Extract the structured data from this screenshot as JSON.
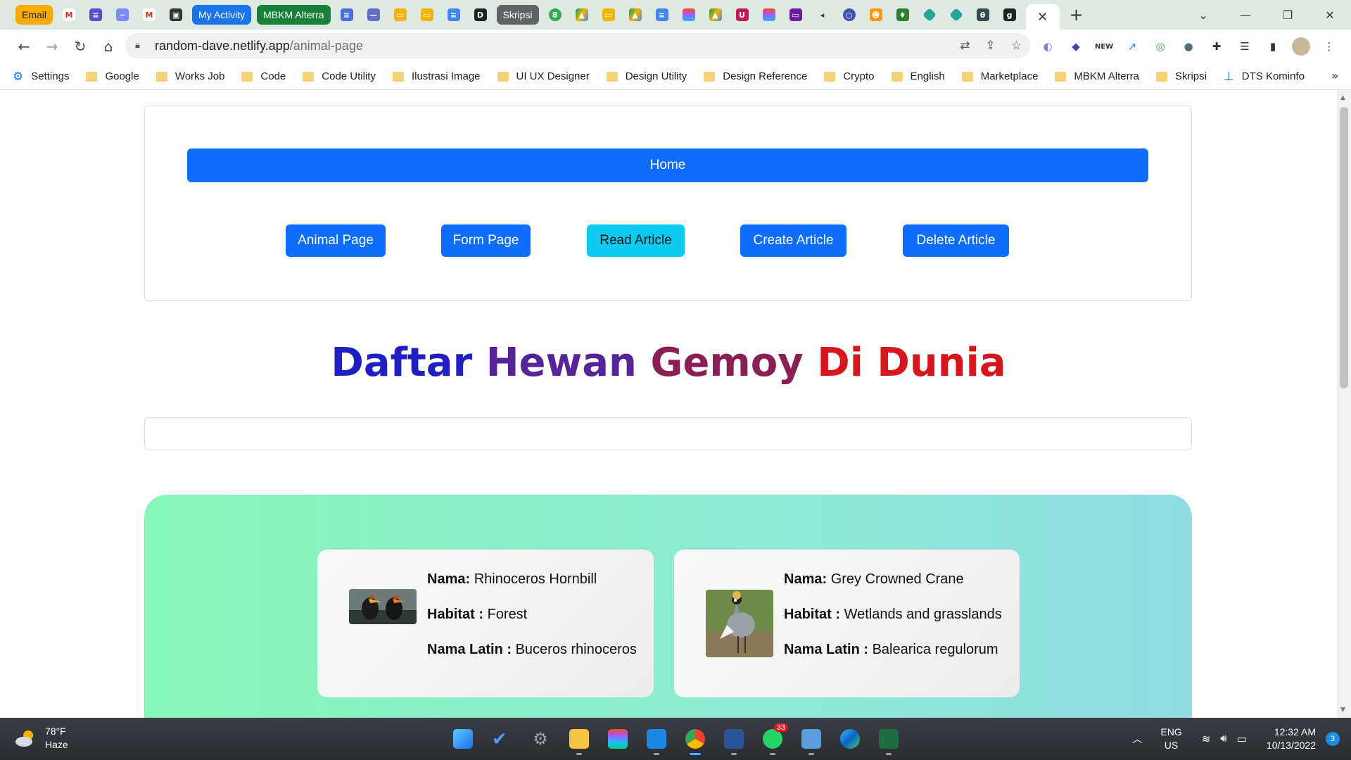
{
  "tabs": {
    "email_chip": "Email",
    "activity_chip": "My Activity",
    "mbkm_chip": "MBKM Alterra",
    "skripsi_chip": "Skripsi",
    "active_close": "✕",
    "new_tab": "+"
  },
  "address": {
    "host": "random-dave.netlify.app",
    "path": "/animal-page"
  },
  "bookmarks": [
    "Settings",
    "Google",
    "Works Job",
    "Code",
    "Code Utility",
    "Ilustrasi Image",
    "UI UX Designer",
    "Design Utility",
    "Design Reference",
    "Crypto",
    "English",
    "Marketplace",
    "MBKM Alterra",
    "Skripsi",
    "DTS Kominfo"
  ],
  "nav": {
    "home": "Home",
    "buttons": [
      "Animal Page",
      "Form Page",
      "Read Article",
      "Create Article",
      "Delete Article"
    ]
  },
  "title": {
    "w1": "Daftar",
    "w2": "Hewan",
    "w3": "Gemoy",
    "w4": "Di",
    "w5": "Dunia"
  },
  "animals": [
    {
      "nama_label": "Nama:",
      "nama": "Rhinoceros Hornbill",
      "habitat_label": "Habitat :",
      "habitat": "Forest",
      "latin_label": "Nama Latin :",
      "latin": "Buceros rhinoceros"
    },
    {
      "nama_label": "Nama:",
      "nama": "Grey Crowned Crane",
      "habitat_label": "Habitat :",
      "habitat": "Wetlands and grasslands",
      "latin_label": "Nama Latin :",
      "latin": "Balearica regulorum"
    }
  ],
  "taskbar": {
    "temp": "78°F",
    "condition": "Haze",
    "lang1": "ENG",
    "lang2": "US",
    "time": "12:32 AM",
    "date": "10/13/2022",
    "notif_count": "3",
    "whatsapp_badge": "33"
  },
  "colors": {
    "primary": "#0d6efd",
    "info": "#0dcaf0"
  }
}
